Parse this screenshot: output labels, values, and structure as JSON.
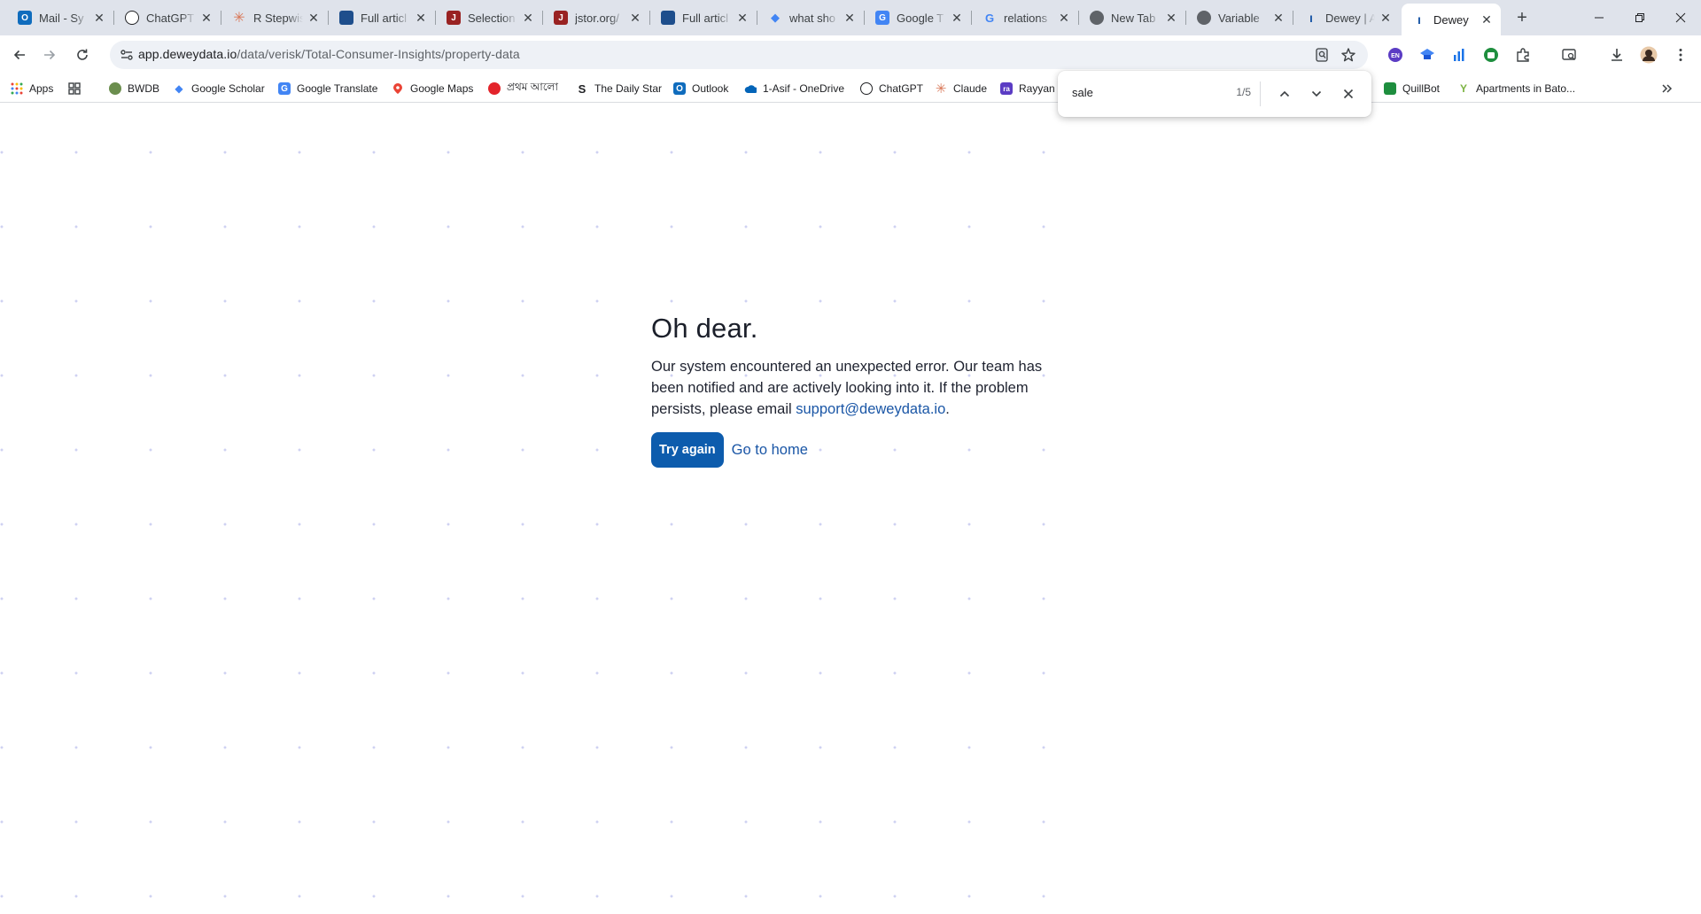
{
  "browser": {
    "tabs": [
      {
        "title": "Mail - Sy",
        "icon": "outlook-icon",
        "color": "#0f6cbd"
      },
      {
        "title": "ChatGPT",
        "icon": "chatgpt-icon",
        "color": "#202124"
      },
      {
        "title": "R Stepwis",
        "icon": "claude-icon",
        "color": "#d97757"
      },
      {
        "title": "Full articl",
        "icon": "wiley-icon",
        "color": "#1e4e8c"
      },
      {
        "title": "Selection",
        "icon": "jstor-icon",
        "color": "#992222"
      },
      {
        "title": "jstor.org/",
        "icon": "jstor-icon",
        "color": "#992222"
      },
      {
        "title": "Full articl",
        "icon": "wiley-icon",
        "color": "#1e4e8c"
      },
      {
        "title": "what sho",
        "icon": "scholar-icon",
        "color": "#4285f4"
      },
      {
        "title": "Google T",
        "icon": "translate-icon",
        "color": "#4285f4"
      },
      {
        "title": "relations",
        "icon": "google-icon",
        "color": "#4285f4"
      },
      {
        "title": "New Tab",
        "icon": "chrome-icon",
        "color": "#5f6368"
      },
      {
        "title": "Variable",
        "icon": "globe-icon",
        "color": "#5f6368"
      },
      {
        "title": "Dewey | A",
        "icon": "dewey-icon",
        "color": "#1a56a6"
      },
      {
        "title": "Dewey",
        "icon": "dewey-icon",
        "color": "#1a56a6",
        "active": true
      }
    ],
    "url_host": "app.deweydata.io",
    "url_path": "/data/verisk/Total-Consumer-Insights/property-data",
    "bookmarks": [
      {
        "label": "Apps",
        "icon": "apps-grid-icon"
      },
      {
        "label": "",
        "icon": "grid-icon"
      },
      {
        "label": "BWDB",
        "icon": "bwdb-icon"
      },
      {
        "label": "Google Scholar",
        "icon": "scholar-icon"
      },
      {
        "label": "Google Translate",
        "icon": "translate-icon"
      },
      {
        "label": "Google Maps",
        "icon": "maps-icon"
      },
      {
        "label": "প্রথম আলো",
        "icon": "prothomalo-icon"
      },
      {
        "label": "The Daily Star",
        "icon": "dailystar-icon"
      },
      {
        "label": "Outlook",
        "icon": "outlook-icon"
      },
      {
        "label": "1-Asif - OneDrive",
        "icon": "onedrive-icon"
      },
      {
        "label": "ChatGPT",
        "icon": "chatgpt-icon"
      },
      {
        "label": "Claude",
        "icon": "claude-icon"
      },
      {
        "label": "Rayyan",
        "icon": "rayyan-icon"
      },
      {
        "label": "QuillBot",
        "icon": "quillbot-icon"
      },
      {
        "label": "Apartments in Bato...",
        "icon": "apartments-icon"
      }
    ],
    "find": {
      "query": "sale",
      "count": "1/5"
    }
  },
  "page": {
    "title": "Oh dear.",
    "message": "Our system encountered an unexpected error. Our team has been notified and are actively looking into it. If the problem persists, please email ",
    "support_email": "support@deweydata.io",
    "message_end": ".",
    "try_again_label": "Try again",
    "go_home_label": "Go to home"
  },
  "colors": {
    "accent": "#0d5cad",
    "link": "#1a56a6",
    "dots": "#cfd2f2"
  }
}
